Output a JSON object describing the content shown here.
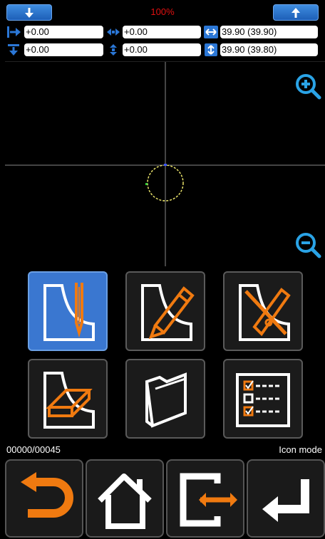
{
  "top_bar": {
    "progress": "100%",
    "down_icon": "arrow-down-icon",
    "up_icon": "arrow-up-icon"
  },
  "fields": {
    "left_offset": "+0.00",
    "bottom_offset": "+0.00",
    "h_move": "+0.00",
    "v_move": "+0.00",
    "width": "39.90 (39.90)",
    "height": "39.90 (39.80)"
  },
  "canvas": {
    "zoom_in_icon": "zoom-in-icon",
    "zoom_out_icon": "zoom-out-icon"
  },
  "tools": [
    {
      "name": "sewing-tool",
      "active": true
    },
    {
      "name": "draw-tool",
      "active": false
    },
    {
      "name": "cut-tool",
      "active": false
    },
    {
      "name": "erase-tool",
      "active": false
    },
    {
      "name": "open-folder-tool",
      "active": false
    },
    {
      "name": "checklist-tool",
      "active": false
    }
  ],
  "status": {
    "counter": "00000/00045",
    "mode": "Icon mode"
  },
  "bottom_buttons": [
    "back-icon",
    "home-icon",
    "switch-icon",
    "enter-icon"
  ],
  "colors": {
    "accent_orange": "#f07a10",
    "accent_blue": "#2b77d6",
    "progress_red": "#e01010"
  }
}
